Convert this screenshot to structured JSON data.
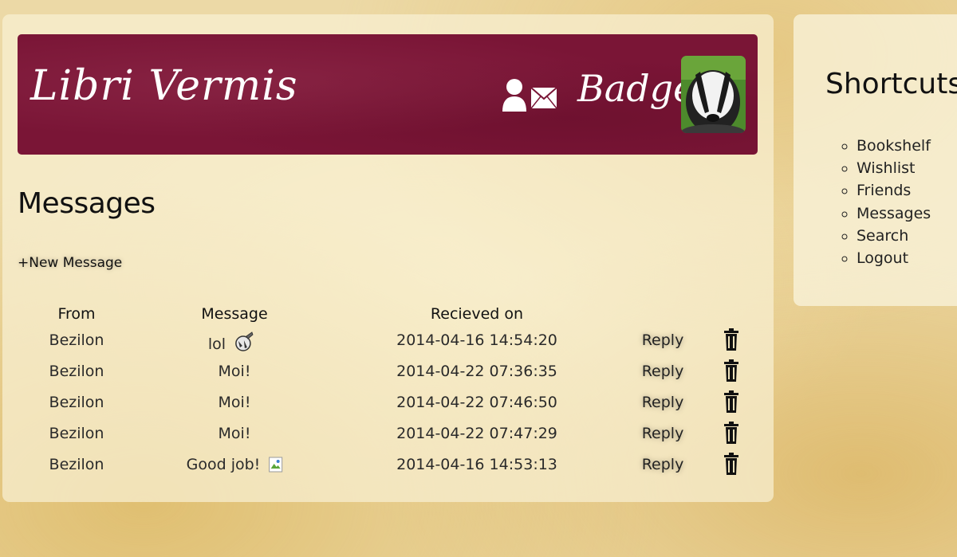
{
  "header": {
    "site_title": "Libri Vermis",
    "username": "Badger"
  },
  "main": {
    "heading": "Messages",
    "new_message_label": "+New Message",
    "columns": {
      "from": "From",
      "message": "Message",
      "received": "Recieved on"
    },
    "rows": [
      {
        "from": "Bezilon",
        "message": "lol",
        "received": "2014-04-16 14:54:20",
        "reply": "Reply"
      },
      {
        "from": "Bezilon",
        "message": "Moi!",
        "received": "2014-04-22 07:36:35",
        "reply": "Reply"
      },
      {
        "from": "Bezilon",
        "message": "Moi!",
        "received": "2014-04-22 07:46:50",
        "reply": "Reply"
      },
      {
        "from": "Bezilon",
        "message": "Moi!",
        "received": "2014-04-22 07:47:29",
        "reply": "Reply"
      },
      {
        "from": "Bezilon",
        "message": "Good job!",
        "received": "2014-04-16 14:53:13",
        "reply": "Reply"
      }
    ]
  },
  "sidebar": {
    "title": "Shortcuts:",
    "items": [
      {
        "label": "Bookshelf"
      },
      {
        "label": "Wishlist"
      },
      {
        "label": "Friends"
      },
      {
        "label": "Messages"
      },
      {
        "label": "Search"
      },
      {
        "label": "Logout"
      }
    ]
  },
  "icons": {
    "profile": "user-icon",
    "messages": "mail-icon",
    "delete": "trash-icon",
    "row_1_emoticon": "emoticon-icon",
    "row_5_emoticon": "broken-image-icon"
  },
  "colors": {
    "header_bg": "#7a1536",
    "text": "#111111"
  }
}
